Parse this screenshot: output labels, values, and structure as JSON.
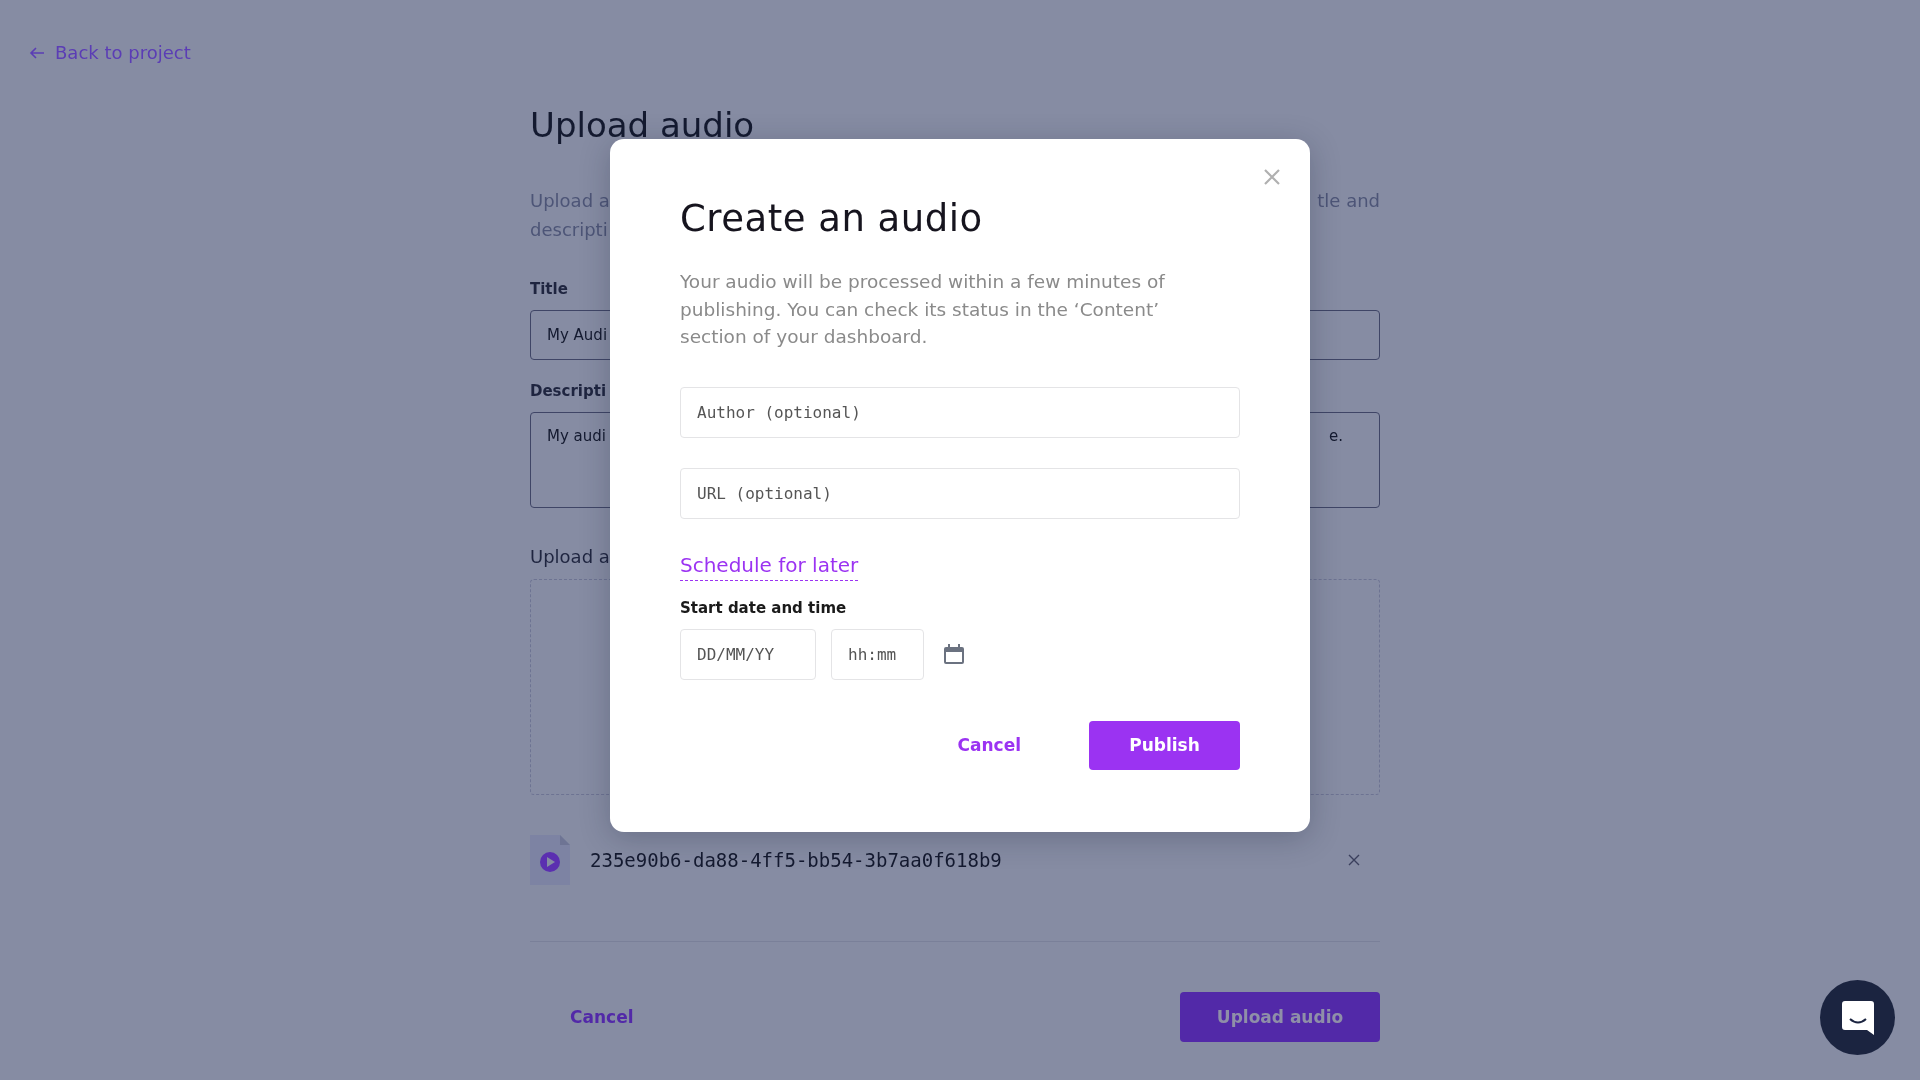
{
  "back_link": {
    "label": "Back to project"
  },
  "page": {
    "heading": "Upload audio",
    "intro_lines": [
      {
        "left": "Upload a",
        "right": "tle and"
      },
      {
        "left": "descripti"
      }
    ],
    "fields": [
      {
        "kind": "input",
        "label": "Title",
        "value_left": "My Audi"
      },
      {
        "kind": "textarea",
        "label": "Descripti",
        "value_left": "My audi",
        "value_right": "e."
      },
      {
        "kind": "dropzone",
        "label": "Upload a"
      }
    ],
    "file": {
      "name": "235e90b6-da88-4ff5-bb54-3b7aa0f618b9"
    },
    "footer": {
      "cancel": "Cancel",
      "submit": "Upload audio"
    }
  },
  "modal": {
    "title": "Create an audio",
    "text": "Your audio will be processed within a few minutes of publishing. You can check its status in the ‘Content’ section of your dashboard.",
    "fields": [
      {
        "placeholder": "Author (optional)"
      },
      {
        "placeholder": "URL (optional)"
      }
    ],
    "schedule_link": "Schedule for later",
    "schedule_label": "Start date and time",
    "date": {
      "placeholder": "DD/MM/YY"
    },
    "time": {
      "placeholder": "hh:mm"
    },
    "cancel": "Cancel",
    "publish": "Publish"
  }
}
